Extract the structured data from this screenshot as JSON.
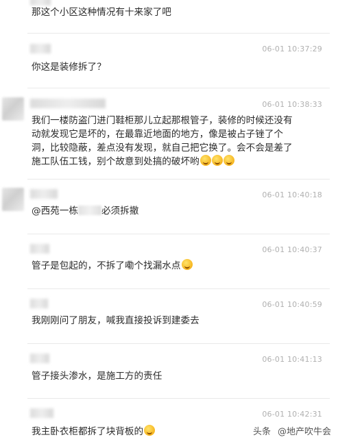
{
  "comments": [
    {
      "time": "",
      "text": "那这个小区这种情况有十来家了吧"
    },
    {
      "time": "06-01 10:37:29",
      "text": "你这是装修拆了？"
    },
    {
      "time": "06-01 10:38:33",
      "text_lines": [
        "我们一楼防盗门进门鞋柜那儿立起那根管子，装修的时候还没有",
        "动就发现它是坏的，在最靠近地面的地方，像是被占子锉了个",
        "洞，比较隐蔽，差点没有发现，就自己把它换了。会不会是差了",
        "施工队伍工钱，别个故意到处搞的破坏哟"
      ],
      "emoji": [
        "grin-emoji",
        "grin-emoji",
        "grin-emoji"
      ]
    },
    {
      "time": "06-01 10:40:18",
      "text_before": "@西苑一栋",
      "text_after": "必须拆撤"
    },
    {
      "time": "06-01 10:40:37",
      "text": "管子是包起的，不拆了嘞个找漏水点",
      "emoji": [
        "sweat-emoji"
      ]
    },
    {
      "time": "06-01 10:40:59",
      "text": "我刚刚问了朋友，喊我直接投诉到建委去"
    },
    {
      "time": "06-01 10:41:13",
      "text": "管子接头渗水，是施工方的责任"
    },
    {
      "time": "06-01 10:42:31",
      "text": "我主卧衣柜都拆了块背板的",
      "emoji": [
        "sleepy-emoji"
      ]
    }
  ],
  "watermark": {
    "part1": "头条",
    "part2": "@地产吹牛会"
  }
}
